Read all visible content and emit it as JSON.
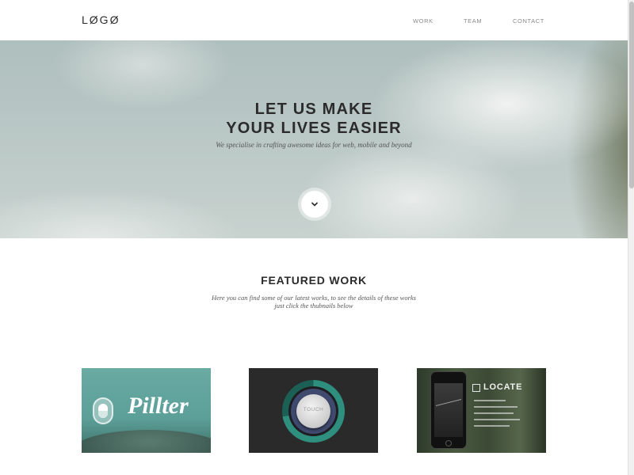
{
  "header": {
    "logo": "LØGØ",
    "nav": [
      {
        "label": "WORK"
      },
      {
        "label": "TEAM"
      },
      {
        "label": "CONTACT"
      }
    ]
  },
  "hero": {
    "title_line1": "LET US MAKE",
    "title_line2": "YOUR LIVES EASIER",
    "subtitle": "We specialise in crafting awesome ideas for web, mobile and beyond",
    "scroll_icon": "chevron-down-icon"
  },
  "featured": {
    "title": "FEATURED WORK",
    "subtitle_line1": "Here you can find some of our latest works, to see the details of these works",
    "subtitle_line2": "just click the thubnails below",
    "items": [
      {
        "name": "Pillter",
        "icon": "pill-icon"
      },
      {
        "name": "TOUCH"
      },
      {
        "name": "LOCATE"
      }
    ]
  },
  "colors": {
    "header_bg": "#ffffff",
    "text_dark": "#2b2b2b",
    "nav_text": "#8a8a8a",
    "accent_teal": "#2e8f7f"
  }
}
